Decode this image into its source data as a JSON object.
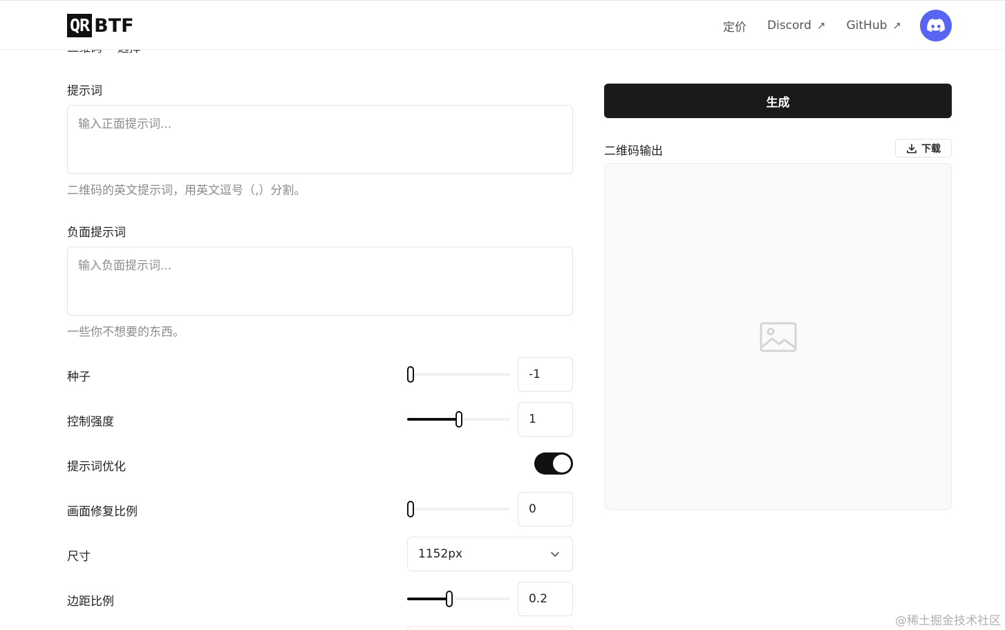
{
  "header": {
    "logo_box": "QR",
    "logo_text": "BTF",
    "nav": [
      {
        "label": "定价",
        "external": false
      },
      {
        "label": "Discord",
        "external": true
      },
      {
        "label": "GitHub",
        "external": true
      }
    ],
    "discord_icon": "discord-icon",
    "discord_color": "#5865f2"
  },
  "cutoff_text": "二维码  ··  选择",
  "form": {
    "prompt": {
      "label": "提示词",
      "placeholder": "输入正面提示词...",
      "hint": "二维码的英文提示词，用英文逗号（,）分割。"
    },
    "negative_prompt": {
      "label": "负面提示词",
      "placeholder": "输入负面提示词...",
      "hint": "一些你不想要的东西。"
    },
    "seed": {
      "label": "种子",
      "value": "-1",
      "slider_fraction": 0.0
    },
    "control_strength": {
      "label": "控制强度",
      "value": "1",
      "slider_fraction": 0.5
    },
    "prompt_optimize": {
      "label": "提示词优化",
      "enabled": true
    },
    "inpaint_ratio": {
      "label": "画面修复比例",
      "value": "0",
      "slider_fraction": 0.0
    },
    "size": {
      "label": "尺寸",
      "value": "1152px"
    },
    "margin_ratio": {
      "label": "边距比例",
      "value": "0.2",
      "slider_fraction": 0.4
    }
  },
  "output": {
    "generate_label": "生成",
    "label": "二维码输出",
    "download_label": "下载",
    "placeholder_icon": "image-icon"
  },
  "watermark": "@稀土掘金技术社区",
  "colors": {
    "accent": "#1a1a1a",
    "discord": "#5865f2"
  }
}
